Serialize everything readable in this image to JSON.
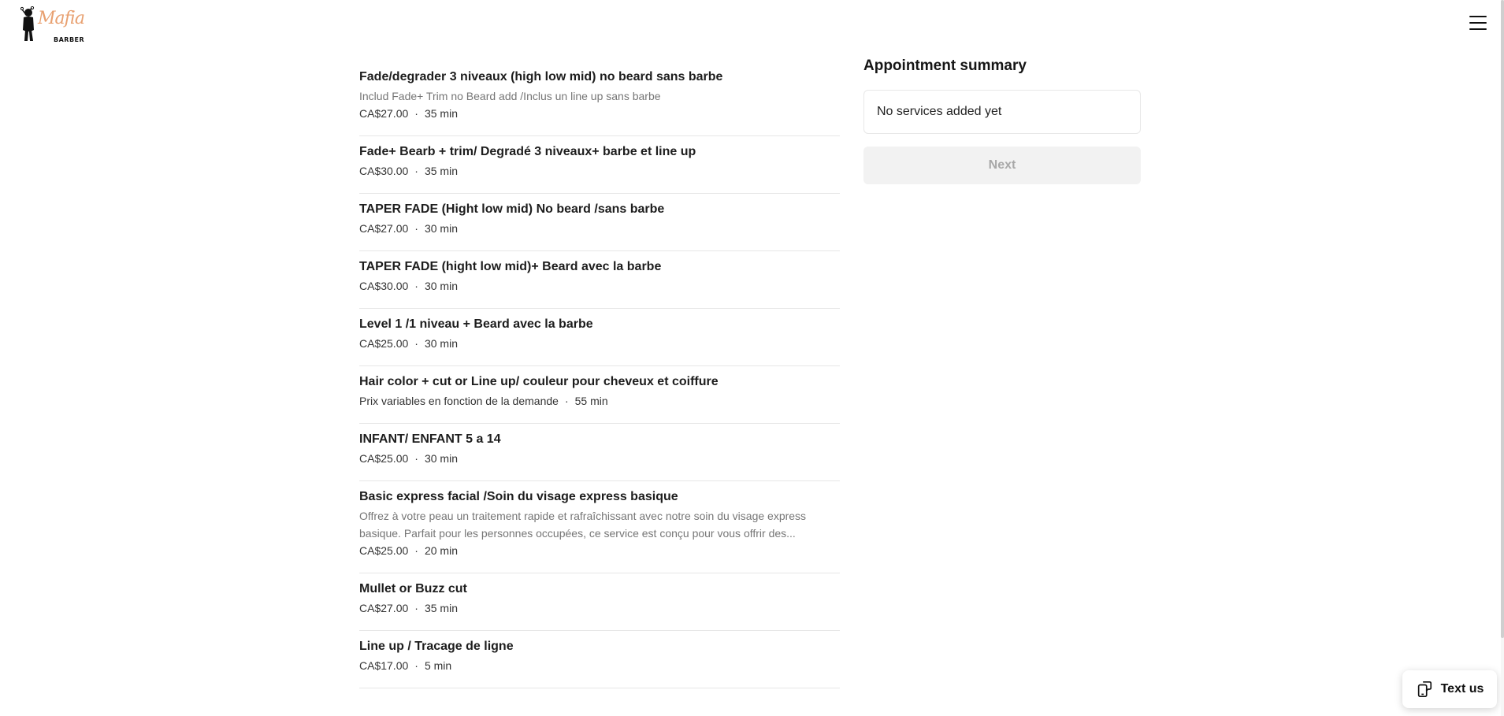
{
  "header": {
    "logo_text": "Mafia",
    "logo_sub": "BARBER"
  },
  "services": [
    {
      "title": "Fade/degrader 3 niveaux (high low mid) no beard sans barbe",
      "description": "Includ Fade+ Trim no Beard add /Inclus un line up sans barbe",
      "price": "CA$27.00",
      "duration": "35 min"
    },
    {
      "title": "Fade+ Bearb + trim/ Degradé 3 niveaux+ barbe et line up",
      "description": "",
      "price": "CA$30.00",
      "duration": "35 min"
    },
    {
      "title": "TAPER FADE (Hight low mid) No beard /sans barbe",
      "description": "",
      "price": "CA$27.00",
      "duration": "30 min"
    },
    {
      "title": "TAPER FADE (hight low mid)+ Beard avec la barbe",
      "description": "",
      "price": "CA$30.00",
      "duration": "30 min"
    },
    {
      "title": "Level 1 /1 niveau + Beard avec la barbe",
      "description": "",
      "price": "CA$25.00",
      "duration": "30 min"
    },
    {
      "title": "Hair color + cut or Line up/ couleur pour cheveux et coiffure",
      "description": "",
      "price": "Prix variables en fonction de la demande",
      "duration": "55 min"
    },
    {
      "title": "INFANT/ ENFANT 5 a 14",
      "description": "",
      "price": "CA$25.00",
      "duration": "30 min"
    },
    {
      "title": "Basic express facial /Soin du visage express basique",
      "description": "Offrez à votre peau un traitement rapide et rafraîchissant avec notre soin du visage express basique. Parfait pour les personnes occupées, ce service est conçu pour vous offrir des...",
      "price": "CA$25.00",
      "duration": "20 min"
    },
    {
      "title": "Mullet or Buzz cut",
      "description": "",
      "price": "CA$27.00",
      "duration": "35 min"
    },
    {
      "title": "Line up / Tracage de ligne",
      "description": "",
      "price": "CA$17.00",
      "duration": "5 min"
    }
  ],
  "summary": {
    "title": "Appointment summary",
    "empty_text": "No services added yet",
    "next_label": "Next"
  },
  "text_us": {
    "label": "Text us"
  },
  "colors": {
    "logo_accent": "#e8a070",
    "next_disabled_bg": "#f2f2f2",
    "next_disabled_text": "#a8a8a8"
  }
}
